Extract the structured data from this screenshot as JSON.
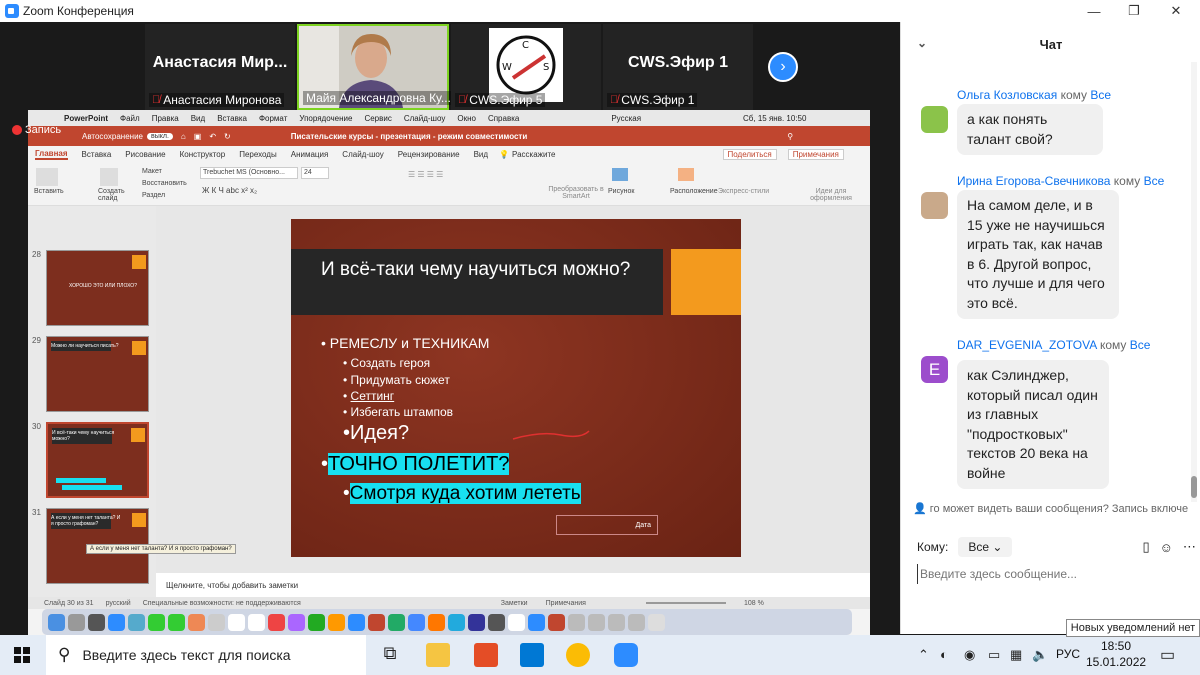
{
  "window": {
    "title": "Zoom Конференция"
  },
  "participants": [
    {
      "display": "Анастасия Мир...",
      "label": "Анастасия Миронова"
    },
    {
      "display": "",
      "label": "Майя Александровна Ку..."
    },
    {
      "display": "",
      "label": "CWS.Эфир 5"
    },
    {
      "display": "CWS.Эфир 1",
      "label": "CWS.Эфир 1"
    }
  ],
  "recording": "Запись",
  "mac_menu": [
    "PowerPoint",
    "Файл",
    "Правка",
    "Вид",
    "Вставка",
    "Формат",
    "Упорядочение",
    "Сервис",
    "Слайд-шоу",
    "Окно",
    "Справка"
  ],
  "mac_status": {
    "lang": "Русская",
    "datetime": "Сб, 15 янв.  10:50"
  },
  "ppt": {
    "autosave": "Автосохранение",
    "autosave_state": "выкл.",
    "doc_title": "Писательские курсы - презентация - режим совместимости",
    "tabs": [
      "Главная",
      "Вставка",
      "Рисование",
      "Конструктор",
      "Переходы",
      "Анимация",
      "Слайд-шоу",
      "Рецензирование",
      "Вид",
      "Расскажите"
    ],
    "share_btn": "Поделиться",
    "comments_btn": "Примечания",
    "ribbon": {
      "paste": "Вставить",
      "create_slide": "Создать слайд",
      "layout": "Макет",
      "reset": "Восстановить",
      "section": "Раздел",
      "font": "Trebuchet MS (Основно...",
      "size": "24",
      "convert": "Преобразовать в SmartArt",
      "picture": "Рисунок",
      "arrange": "Расположение",
      "express": "Экспресс-стили",
      "ideas": "Идеи для оформления"
    },
    "thumbs": [
      {
        "num": "28",
        "text": "ХОРОШО ЭТО ИЛИ ПЛОХО?"
      },
      {
        "num": "29",
        "text": "Можно ли научиться писать?"
      },
      {
        "num": "30",
        "text": "И всё-таки чему научиться можно?"
      },
      {
        "num": "31",
        "text": "А если у меня нет таланта? И я просто графоман?"
      }
    ],
    "tooltip": "А если у меня нет таланта? И я просто графоман?",
    "slide": {
      "title": "И всё-таки чему научиться можно?",
      "b1": "РЕМЕСЛУ и ТЕХНИКАМ",
      "s1": "Создать героя",
      "s2": "Придумать сюжет",
      "s3": "Сеттинг",
      "s4": "Избегать штампов",
      "b2": "Идея?",
      "b3": "ТОЧНО ПОЛЕТИТ?",
      "b4": "Смотря куда хотим лететь",
      "date": "Дата"
    },
    "notes": "Щелкните, чтобы добавить заметки",
    "status": {
      "slide": "Слайд 30 из 31",
      "lang": "русский",
      "access": "Специальные возможности: не поддерживаются",
      "notes": "Заметки",
      "comments": "Примечания",
      "zoom": "108 %"
    }
  },
  "chat": {
    "title": "Чат",
    "messages": [
      {
        "sender": "Ольга Козловская",
        "to_word": "кому",
        "to": "Все",
        "text": "а как понять талант свой?"
      },
      {
        "sender": "Ирина Егорова-Свечникова",
        "to_word": "кому",
        "to": "Все",
        "text": "На самом деле, и в 15 уже не научишься играть так, как начав в 6. Другой вопрос, что лучше и для чего это всё."
      },
      {
        "sender": "DAR_EVGENIA_ZOTOVA",
        "to_word": "кому",
        "to": "Все",
        "avatar_letter": "E",
        "text": "как Сэлинджер, который писал один из главных \"подростковых\" текстов 20 века на войне"
      }
    ],
    "who_can_see": "го может видеть ваши сообщения? Запись включе",
    "to_label": "Кому:",
    "to_value": "Все",
    "placeholder": "Введите здесь сообщение..."
  },
  "notification": "Новых уведомлений нет",
  "taskbar": {
    "search": "Введите здесь текст для поиска",
    "lang": "РУС",
    "time": "18:50",
    "date": "15.01.2022"
  },
  "colors": {
    "accent": "#2d8cff",
    "ppt": "#c0462f",
    "slide_orange": "#f39a1e",
    "highlight": "#18e0f0"
  }
}
